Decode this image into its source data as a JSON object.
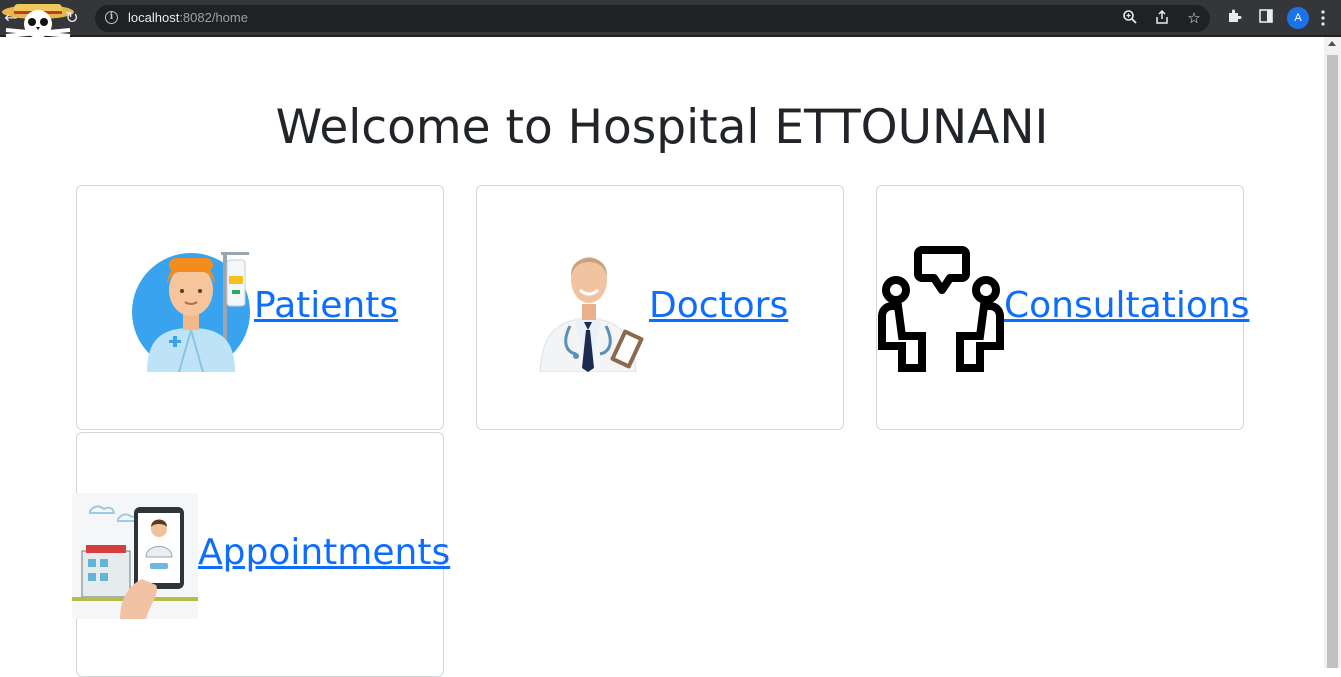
{
  "browser": {
    "url_host": "localhost",
    "url_path": ":8082/home",
    "profile_initial": "A"
  },
  "page": {
    "title": "Welcome to Hospital ETTOUNANI"
  },
  "cards": [
    {
      "label": "Patients",
      "icon": "patient-icon"
    },
    {
      "label": "Doctors",
      "icon": "doctor-icon"
    },
    {
      "label": "Consultations",
      "icon": "consultation-icon"
    },
    {
      "label": "Appointments",
      "icon": "appointment-icon"
    }
  ],
  "colors": {
    "link": "#0d6efd",
    "title": "#212529",
    "card_border": "#d3d6da",
    "browser_bar": "#35363a"
  }
}
